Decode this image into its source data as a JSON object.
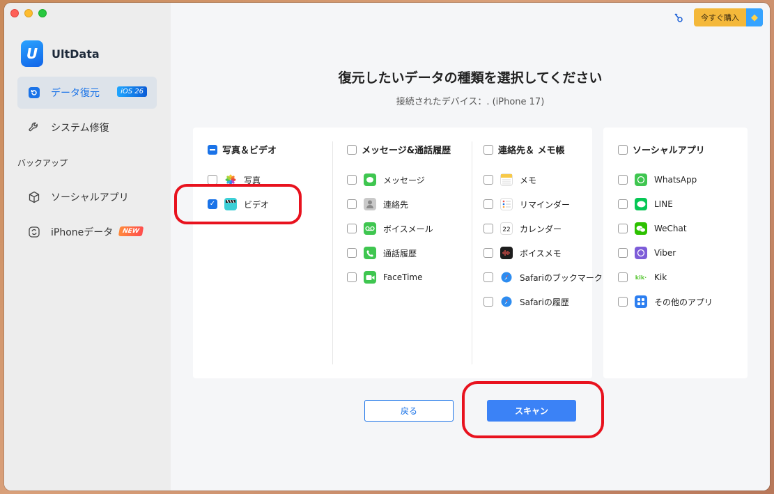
{
  "app": {
    "name": "UltData"
  },
  "sidebar": {
    "items": [
      {
        "label": "データ復元",
        "badge": "iOS 26"
      },
      {
        "label": "システム修復"
      }
    ],
    "section_label": "バックアップ",
    "backup_items": [
      {
        "label": "ソーシャルアプリ"
      },
      {
        "label": "iPhoneデータ",
        "badge": "NEW"
      }
    ]
  },
  "header": {
    "buy_label": "今すぐ購入",
    "title": "復元したいデータの種類を選択してください",
    "subtitle": "接続されたデバイス：. (iPhone 17)"
  },
  "categories": [
    {
      "head": "写真＆ビデオ",
      "state": "partial",
      "items": [
        {
          "label": "写真",
          "icon": "photos-icon",
          "checked": false
        },
        {
          "label": "ビデオ",
          "icon": "video-clapper-icon",
          "checked": true
        }
      ]
    },
    {
      "head": "メッセージ&通話履歴",
      "state": "unchecked",
      "items": [
        {
          "label": "メッセージ",
          "icon": "messages-icon",
          "checked": false
        },
        {
          "label": "連絡先",
          "icon": "contacts-icon",
          "checked": false
        },
        {
          "label": "ボイスメール",
          "icon": "voicemail-icon",
          "checked": false
        },
        {
          "label": "通話履歴",
          "icon": "phone-icon",
          "checked": false
        },
        {
          "label": "FaceTime",
          "icon": "facetime-icon",
          "checked": false
        }
      ]
    },
    {
      "head": "連絡先＆ メモ帳",
      "state": "unchecked",
      "items": [
        {
          "label": "メモ",
          "icon": "notes-icon",
          "checked": false
        },
        {
          "label": "リマインダー",
          "icon": "reminders-icon",
          "checked": false
        },
        {
          "label": "カレンダー",
          "icon": "calendar-icon",
          "checked": false
        },
        {
          "label": "ボイスメモ",
          "icon": "voice-memo-icon",
          "checked": false
        },
        {
          "label": "Safariのブックマーク",
          "icon": "safari-icon",
          "checked": false
        },
        {
          "label": "Safariの履歴",
          "icon": "safari-icon",
          "checked": false
        }
      ]
    },
    {
      "head": "ソーシャルアプリ",
      "state": "unchecked",
      "items": [
        {
          "label": "WhatsApp",
          "icon": "whatsapp-icon",
          "checked": false
        },
        {
          "label": "LINE",
          "icon": "line-icon",
          "checked": false
        },
        {
          "label": "WeChat",
          "icon": "wechat-icon",
          "checked": false
        },
        {
          "label": "Viber",
          "icon": "viber-icon",
          "checked": false
        },
        {
          "label": "Kik",
          "icon": "kik-icon",
          "checked": false
        },
        {
          "label": "その他のアプリ",
          "icon": "other-apps-icon",
          "checked": false
        }
      ]
    }
  ],
  "icon_glyphs": {
    "calendar_day": "22",
    "kik_text": "kik·"
  },
  "buttons": {
    "back": "戻る",
    "scan": "スキャン"
  },
  "colors": {
    "accent": "#1a73e8",
    "annotation": "#e8121e"
  }
}
